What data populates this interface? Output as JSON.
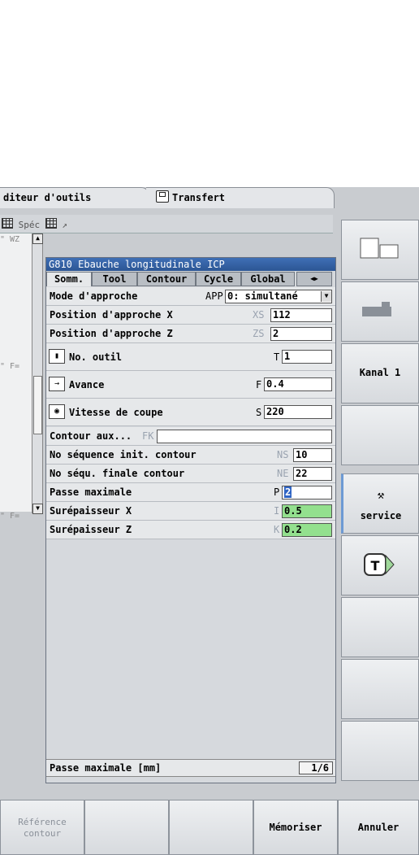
{
  "tabs": [
    {
      "label": "diteur d'outils"
    },
    {
      "label": "Transfert"
    }
  ],
  "header": {
    "spec_label": "Spéc",
    "arrow": "↗"
  },
  "left_lines": [
    "\" WZ",
    "\" F=",
    "\" F="
  ],
  "dialog": {
    "title": "G810 Ebauche longitudinale ICP",
    "tabs": [
      "Somm.",
      "Tool",
      "Contour",
      "Cycle",
      "Global"
    ],
    "rows": [
      {
        "label": "Mode d'approche",
        "var": "APP",
        "value": "0: simultané"
      },
      {
        "label": "Position d'approche X",
        "var": "XS",
        "value": "112"
      },
      {
        "label": "Position d'approche Z",
        "var": "ZS",
        "value": "2"
      },
      {
        "label": "No. outil",
        "var": "T",
        "value": "1"
      },
      {
        "label": "Avance",
        "var": "F",
        "value": "0.4"
      },
      {
        "label": "Vitesse de coupe",
        "var": "S",
        "value": "220"
      },
      {
        "label": "Contour aux...",
        "var": "FK",
        "value": ""
      },
      {
        "label": "No séquence init. contour",
        "var": "NS",
        "value": "10"
      },
      {
        "label": "No séqu. finale contour",
        "var": "NE",
        "value": "22"
      },
      {
        "label": "Passe maximale",
        "var": "P",
        "value": "2"
      },
      {
        "label": "Surépaisseur X",
        "var": "I",
        "value": "0.5"
      },
      {
        "label": "Surépaisseur Z",
        "var": "K",
        "value": "0.2"
      }
    ],
    "status_text": "Passe maximale [mm]",
    "page": "1/6"
  },
  "right_keys": {
    "kanal": "Kanal 1",
    "service": "service"
  },
  "bottom_keys": {
    "reference_line1": "Référence",
    "reference_line2": "contour",
    "save": "Mémoriser",
    "cancel": "Annuler"
  },
  "colors": {
    "title_bar": "#2c5694",
    "green_field": "#93e08e",
    "selection": "#2f64c4"
  }
}
